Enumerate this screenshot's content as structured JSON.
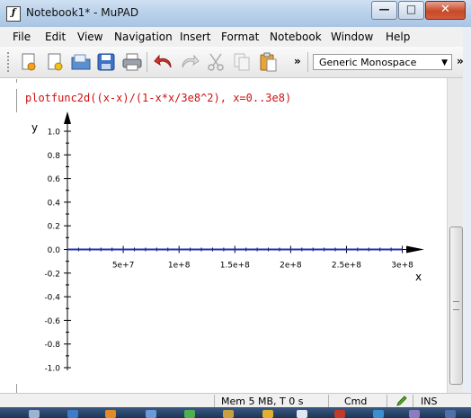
{
  "window": {
    "title": "Notebook1* - MuPAD",
    "app_icon": "mupad-icon"
  },
  "menu": [
    "File",
    "Edit",
    "View",
    "Navigation",
    "Insert",
    "Format",
    "Notebook",
    "Window",
    "Help"
  ],
  "toolbar": {
    "buttons": [
      "new-notebook-icon",
      "new-editor-icon",
      "open-icon",
      "save-icon",
      "print-icon",
      "undo-icon",
      "redo-icon",
      "cut-icon",
      "copy-icon",
      "paste-icon"
    ],
    "font_combo": "Generic Monospace",
    "overflow": "»"
  },
  "notebook": {
    "command": "plotfunc2d((x-x)/(1-x*x/3e8^2), x=0..3e8)"
  },
  "chart_data": {
    "type": "line",
    "xlabel": "x",
    "ylabel": "y",
    "xlim": [
      0,
      310000000.0
    ],
    "ylim": [
      -1.0,
      1.0
    ],
    "x_ticks": [
      50000000.0,
      100000000.0,
      150000000.0,
      200000000.0,
      250000000.0,
      300000000.0
    ],
    "x_tick_labels": [
      "5e+7",
      "1e+8",
      "1.5e+8",
      "2e+8",
      "2.5e+8",
      "3e+8"
    ],
    "y_ticks": [
      1.0,
      0.8,
      0.6,
      0.4,
      0.2,
      0.0,
      -0.2,
      -0.4,
      -0.6,
      -0.8,
      -1.0
    ],
    "y_tick_labels": [
      "1.0",
      "0.8",
      "0.6",
      "0.4",
      "0.2",
      "0.0",
      "-0.2",
      "-0.4",
      "-0.6",
      "-0.8",
      "-1.0"
    ],
    "series": [
      {
        "x": [
          0,
          300000000.0
        ],
        "values": [
          0,
          0
        ],
        "color": "#1f2fb5"
      }
    ],
    "grid": false
  },
  "status": {
    "memory": "Mem 5 MB, T 0 s",
    "mode": "Cmd",
    "insert": "INS"
  }
}
